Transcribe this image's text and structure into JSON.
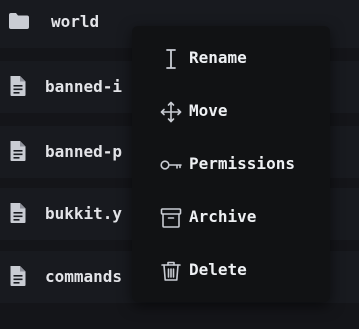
{
  "files": [
    {
      "name": "world",
      "type": "folder",
      "icon": "folder-icon"
    },
    {
      "name": "banned-i",
      "type": "file",
      "icon": "file-text-icon"
    },
    {
      "name": "banned-p",
      "type": "file",
      "icon": "file-text-icon"
    },
    {
      "name": "bukkit.y",
      "type": "file",
      "icon": "file-text-icon"
    },
    {
      "name": "commands",
      "type": "file",
      "icon": "file-text-icon"
    }
  ],
  "context_menu": {
    "items": [
      {
        "label": "Rename",
        "icon": "text-cursor-icon"
      },
      {
        "label": "Move",
        "icon": "move-arrows-icon"
      },
      {
        "label": "Permissions",
        "icon": "key-icon"
      },
      {
        "label": "Archive",
        "icon": "archive-box-icon"
      },
      {
        "label": "Delete",
        "icon": "trash-icon"
      }
    ]
  },
  "colors": {
    "background": "#141519",
    "row": "#181a1f",
    "menu": "#111214",
    "text": "#e3e4e8",
    "icon": "#c9ccd3"
  }
}
